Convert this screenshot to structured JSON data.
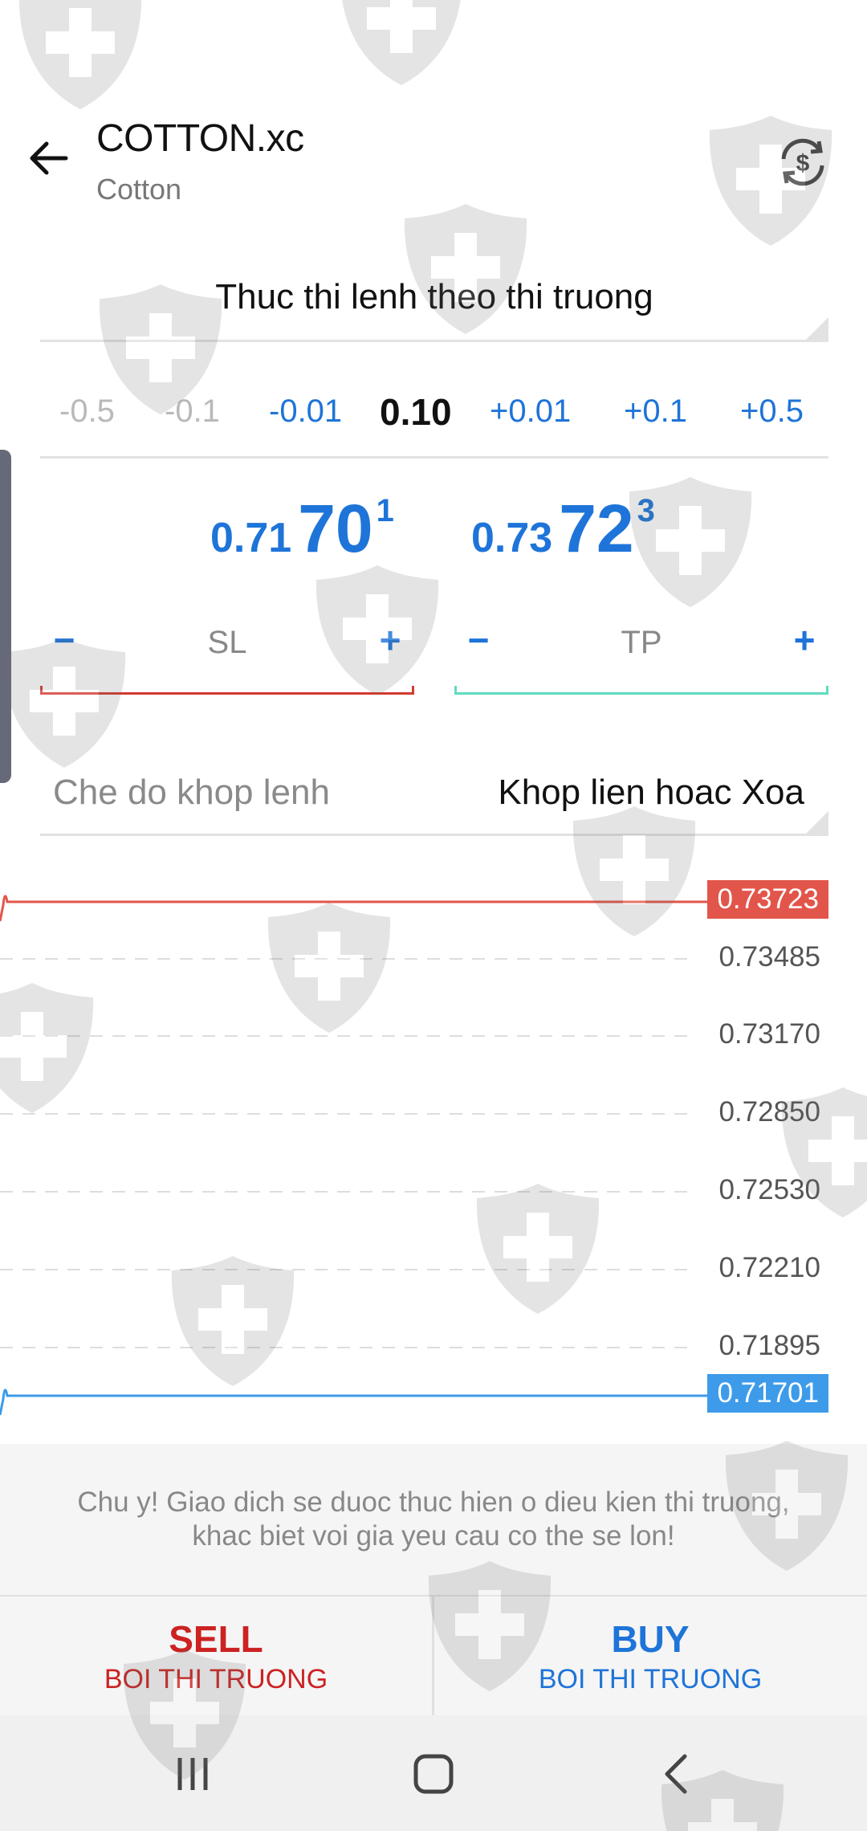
{
  "header": {
    "title": "COTTON.xc",
    "subtitle": "Cotton"
  },
  "order_type": "Thuc thi lenh theo thi truong",
  "volume": {
    "steps_left": [
      "-0.5",
      "-0.1",
      "-0.01"
    ],
    "current": "0.10",
    "steps_right": [
      "+0.01",
      "+0.1",
      "+0.5"
    ]
  },
  "prices": {
    "bid": {
      "prefix": "0.71",
      "big": "70",
      "sup": "1"
    },
    "ask": {
      "prefix": "0.73",
      "big": "72",
      "sup": "3"
    }
  },
  "sl": {
    "label": "SL",
    "minus": "−",
    "plus": "+"
  },
  "tp": {
    "label": "TP",
    "minus": "−",
    "plus": "+"
  },
  "fill_policy": {
    "label": "Che do khop lenh",
    "value": "Khop lien hoac Xoa"
  },
  "chart_data": {
    "type": "line",
    "series": [
      {
        "values": [
          0.73723,
          0.73723
        ]
      },
      {
        "values": [
          0.71701,
          0.71701
        ]
      }
    ],
    "ask_label": "0.73723",
    "bid_label": "0.71701",
    "y_ticks": [
      "0.73485",
      "0.73170",
      "0.72850",
      "0.72530",
      "0.72210",
      "0.71895"
    ],
    "grid": true,
    "colors": {
      "ask": "#e2554a",
      "bid": "#3d9be9"
    }
  },
  "notice": {
    "line1": "Chu y! Giao dich se duoc thuc hien o dieu kien thi truong,",
    "line2": "khac biet voi gia yeu cau co the se lon!"
  },
  "actions": {
    "sell": {
      "label": "SELL",
      "sub": "BOI THI TRUONG"
    },
    "buy": {
      "label": "BUY",
      "sub": "BOI THI TRUONG"
    }
  },
  "colors": {
    "accent": "#1e74d8",
    "sell": "#cc2222",
    "sl_line": "#d33a31",
    "tp_line": "#60dcc0"
  },
  "icons": {
    "back": "arrow-left-icon",
    "currency": "currency-exchange-icon",
    "nav_recents": "recents-icon",
    "nav_home": "home-icon",
    "nav_back": "chevron-left-icon",
    "watermark": "shield-cross-icon"
  }
}
